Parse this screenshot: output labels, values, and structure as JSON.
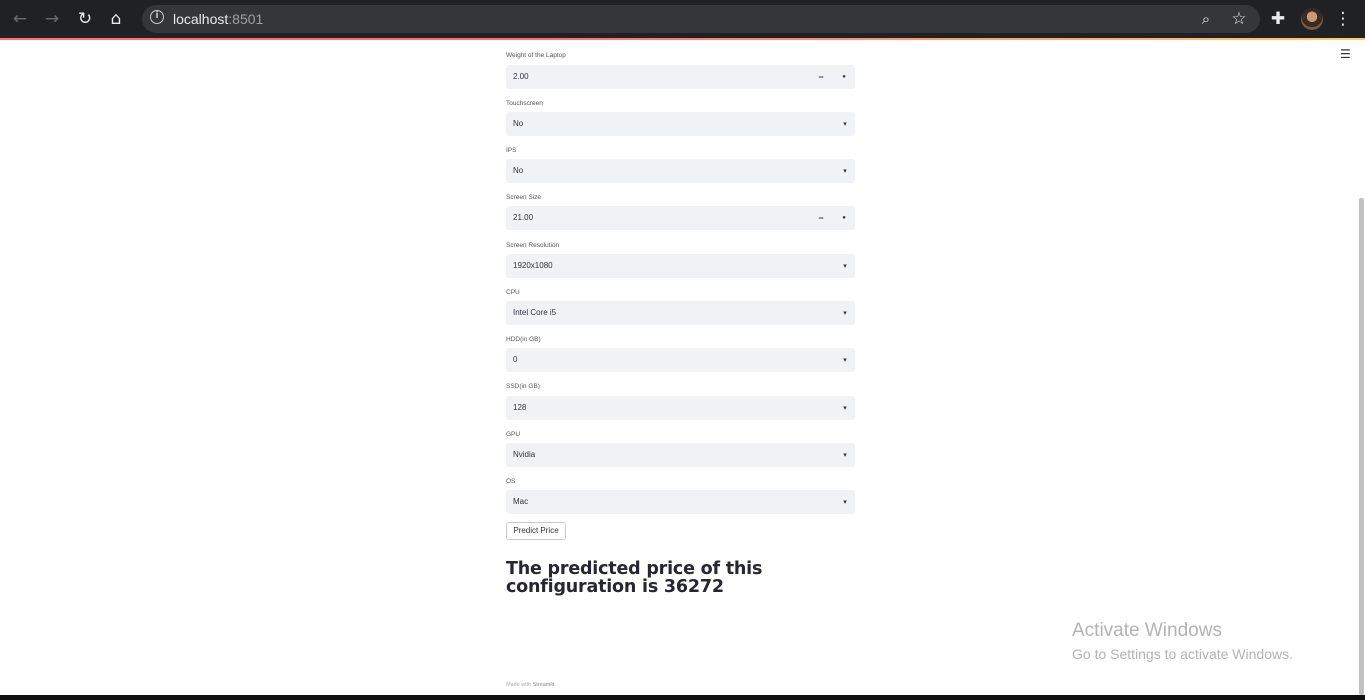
{
  "browser": {
    "url_host": "localhost",
    "url_port": ":8501",
    "icons": [
      "back-icon",
      "forward-icon",
      "reload-icon",
      "home-icon",
      "info-icon",
      "zoom-icon",
      "star-icon",
      "extensions-icon",
      "profile-avatar",
      "menu-icon"
    ]
  },
  "app_menu_icon": "☰",
  "form": {
    "fields": [
      {
        "label": "Weight of the Laptop",
        "value": "2.00",
        "type": "number"
      },
      {
        "label": "Touchscreen",
        "value": "No",
        "type": "select"
      },
      {
        "label": "IPS",
        "value": "No",
        "type": "select"
      },
      {
        "label": "Screen Size",
        "value": "21.00",
        "type": "number"
      },
      {
        "label": "Screen Resolution",
        "value": "1920x1080",
        "type": "select"
      },
      {
        "label": "CPU",
        "value": "Intel Core i5",
        "type": "select"
      },
      {
        "label": "HDD(in GB)",
        "value": "0",
        "type": "select"
      },
      {
        "label": "SSD(in GB)",
        "value": "128",
        "type": "select"
      },
      {
        "label": "GPU",
        "value": "Nvidia",
        "type": "select"
      },
      {
        "label": "OS",
        "value": "Mac",
        "type": "select"
      }
    ],
    "stepper_minus": "−",
    "stepper_plus": "●",
    "caret": "▾",
    "predict_button": "Predict Price"
  },
  "result_text": "The predicted price of this configuration is 36272",
  "footer": {
    "prefix": "Made with",
    "brand": "Streamlit"
  },
  "watermark": {
    "title": "Activate Windows",
    "subtitle": "Go to Settings to activate Windows."
  },
  "colors": {
    "chrome_bg": "#202124",
    "input_bg": "#f0f2f6",
    "accent": "#ff4b4b",
    "text": "#31333f"
  }
}
